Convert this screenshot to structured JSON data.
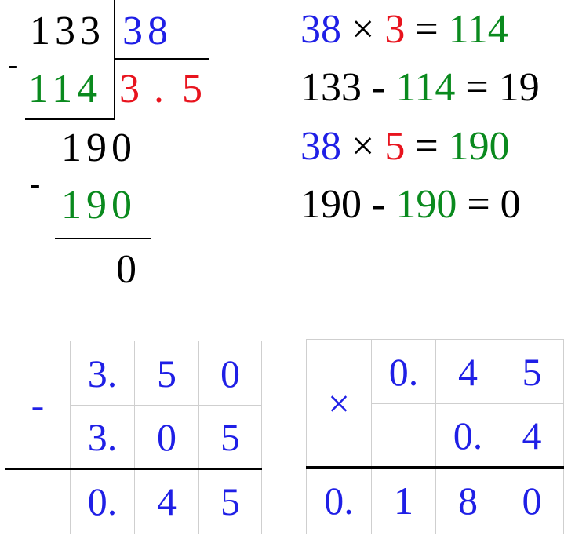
{
  "division": {
    "dividend": "133",
    "divisor": "38",
    "quotient_first": "3",
    "quotient_dot": ".",
    "quotient_second": "5",
    "minus_sign": "-",
    "sub1": "114",
    "remainder1": "190",
    "sub2": "190",
    "remainder2": "0"
  },
  "equations": [
    {
      "a": "38",
      "op": "×",
      "b": "3",
      "eq": "=",
      "r": "114"
    },
    {
      "a": "133",
      "op": "-",
      "b": "114",
      "eq": "=",
      "r": "19"
    },
    {
      "a": "38",
      "op": "×",
      "b": "5",
      "eq": "=",
      "r": "190"
    },
    {
      "a": "190",
      "op": "-",
      "b": "190",
      "eq": "=",
      "r": "0"
    }
  ],
  "subtraction_table": {
    "operator": "-",
    "row1": [
      "3.",
      "5",
      "0"
    ],
    "row2": [
      "3.",
      "0",
      "5"
    ],
    "result": [
      "0.",
      "4",
      "5"
    ]
  },
  "multiplication_table": {
    "operator": "×",
    "row1": [
      "0.",
      "4",
      "5"
    ],
    "row2": [
      "",
      "0.",
      "4"
    ],
    "result": [
      "0.",
      "1",
      "8",
      "0"
    ]
  },
  "colors": {
    "blue": "#1f1fe6",
    "red": "#e8141e",
    "green": "#0a8a1e"
  }
}
